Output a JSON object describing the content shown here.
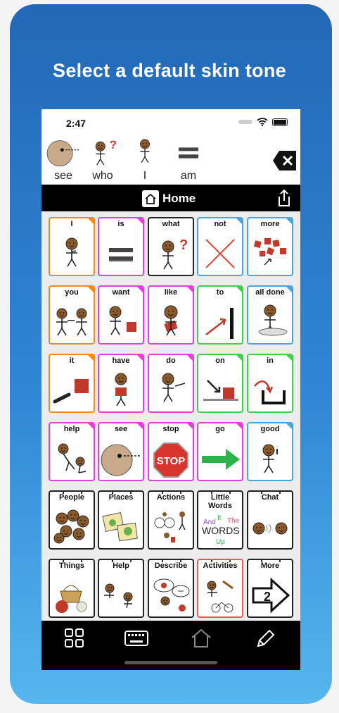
{
  "headline": "Select a default skin tone",
  "status": {
    "time": "2:47"
  },
  "message_bar": {
    "words": [
      {
        "label": "see",
        "icon": "eye-face-icon"
      },
      {
        "label": "who",
        "icon": "question-person-icon"
      },
      {
        "label": "I",
        "icon": "self-person-icon"
      },
      {
        "label": "am",
        "icon": "equals-icon"
      }
    ]
  },
  "nav": {
    "title": "Home"
  },
  "rows": [
    [
      {
        "label": "I",
        "color": "orange",
        "icon": "person-pointing-self-icon"
      },
      {
        "label": "is",
        "color": "magenta",
        "icon": "equals-icon"
      },
      {
        "label": "what",
        "color": "black",
        "icon": "question-person-icon"
      },
      {
        "label": "not",
        "color": "blue",
        "icon": "red-x-icon"
      },
      {
        "label": "more",
        "color": "blue",
        "icon": "red-squares-icon"
      }
    ],
    [
      {
        "label": "you",
        "color": "orange",
        "icon": "two-people-icon"
      },
      {
        "label": "want",
        "color": "magenta",
        "icon": "person-reaching-icon"
      },
      {
        "label": "like",
        "color": "magenta",
        "icon": "person-hug-icon"
      },
      {
        "label": "to",
        "color": "green",
        "icon": "arrow-to-line-icon"
      },
      {
        "label": "all done",
        "color": "blue",
        "icon": "person-at-table-icon"
      }
    ],
    [
      {
        "label": "it",
        "color": "orange",
        "icon": "pointing-hand-box-icon"
      },
      {
        "label": "have",
        "color": "magenta",
        "icon": "person-holding-box-icon"
      },
      {
        "label": "do",
        "color": "magenta",
        "icon": "person-acting-icon"
      },
      {
        "label": "on",
        "color": "green",
        "icon": "arrow-on-box-icon"
      },
      {
        "label": "in",
        "color": "green",
        "icon": "arrow-into-container-icon"
      }
    ],
    [
      {
        "label": "help",
        "color": "magenta",
        "icon": "person-helping-icon"
      },
      {
        "label": "see",
        "color": "magenta",
        "icon": "eye-face-icon"
      },
      {
        "label": "stop",
        "color": "magenta",
        "icon": "stop-sign-icon"
      },
      {
        "label": "go",
        "color": "magenta",
        "icon": "green-arrow-icon"
      },
      {
        "label": "good",
        "color": "blue",
        "icon": "thumbs-up-person-icon"
      }
    ],
    [
      {
        "label": "People",
        "color": "black",
        "folder": true,
        "icon": "group-faces-icon"
      },
      {
        "label": "Places",
        "color": "black",
        "folder": true,
        "icon": "maps-icon"
      },
      {
        "label": "Actions",
        "color": "black",
        "folder": true,
        "icon": "actions-icon"
      },
      {
        "label": "Little Words",
        "color": "black",
        "folder": true,
        "icon": "words-collage-icon",
        "collage": [
          "And",
          "It",
          "The",
          "WORDS",
          "Up"
        ]
      },
      {
        "label": "Chat",
        "color": "black",
        "folder": true,
        "icon": "chat-faces-icon"
      }
    ],
    [
      {
        "label": "Things",
        "color": "black",
        "folder": true,
        "icon": "basket-ball-icon"
      },
      {
        "label": "Help",
        "color": "black",
        "folder": true,
        "icon": "help-people-icon"
      },
      {
        "label": "Describe",
        "color": "black",
        "folder": true,
        "icon": "describe-icon"
      },
      {
        "label": "Activities",
        "color": "red",
        "folder": true,
        "icon": "activities-icon"
      },
      {
        "label": "More",
        "color": "black",
        "folder": true,
        "icon": "arrow-2-icon",
        "badge": "2"
      }
    ]
  ],
  "bottom_bar": [
    "grid-icon",
    "keyboard-icon",
    "home-icon",
    "pencil-icon"
  ]
}
